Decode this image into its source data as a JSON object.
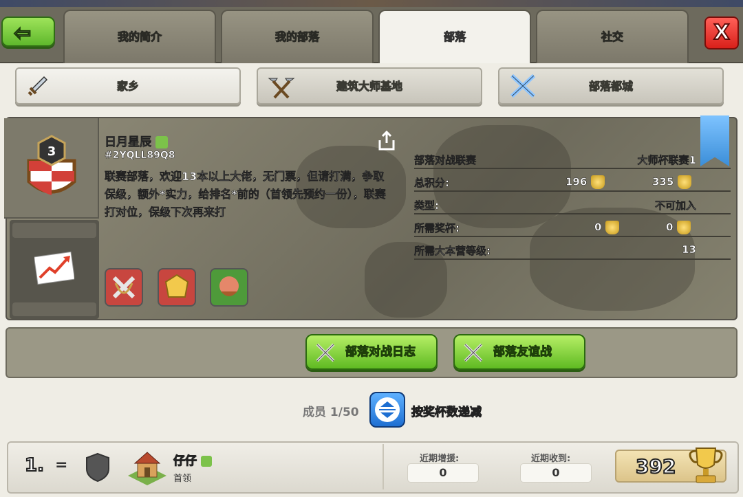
{
  "top_tabs": [
    {
      "label": "我的简介",
      "active": false
    },
    {
      "label": "我的部落",
      "active": false
    },
    {
      "label": "部落",
      "active": true
    },
    {
      "label": "社交",
      "active": false
    }
  ],
  "close_label": "X",
  "sub_tabs": [
    {
      "label": "家乡",
      "icon": "sword-icon"
    },
    {
      "label": "建筑大师基地",
      "icon": "hammers-icon"
    },
    {
      "label": "部落都城",
      "icon": "crossed-swords-icon"
    }
  ],
  "clan": {
    "level": "3",
    "name": "日月星辰",
    "tag": "#2YQLL89Q8",
    "description": "联赛部落，欢迎13本以上大佬，无门票，但请打满，争取保级，额外*实力，给排名*前的（首领先预约一份），联赛打对位，保级下次再来打"
  },
  "info": {
    "war_league_label": "部落对战联赛",
    "war_league_value": "大师杯联赛1",
    "points_label": "总积分:",
    "points_main": "196",
    "points_builder": "335",
    "type_label": "类型:",
    "type_value": "不可加入",
    "trophies_label": "所需奖杯:",
    "trophies_main": "0",
    "trophies_builder": "0",
    "th_label": "所需大本营等级:",
    "th_value": "13"
  },
  "actions": {
    "war_log": "部落对战日志",
    "friendly_war": "部落友谊战"
  },
  "members_label": "成员 1/50",
  "sort_label": "按奖杯数递减",
  "member": {
    "rank": "1.",
    "rank_change": "=",
    "name": "仔仔",
    "role": "首领",
    "donated_label": "近期增援:",
    "donated_value": "0",
    "received_label": "近期收到:",
    "received_value": "0",
    "trophies": "392"
  },
  "colors": {
    "green_button": "#5fba22",
    "close_red": "#d8201a",
    "sort_blue": "#1e6fd2",
    "banner_blue": "#3b8ed8"
  }
}
